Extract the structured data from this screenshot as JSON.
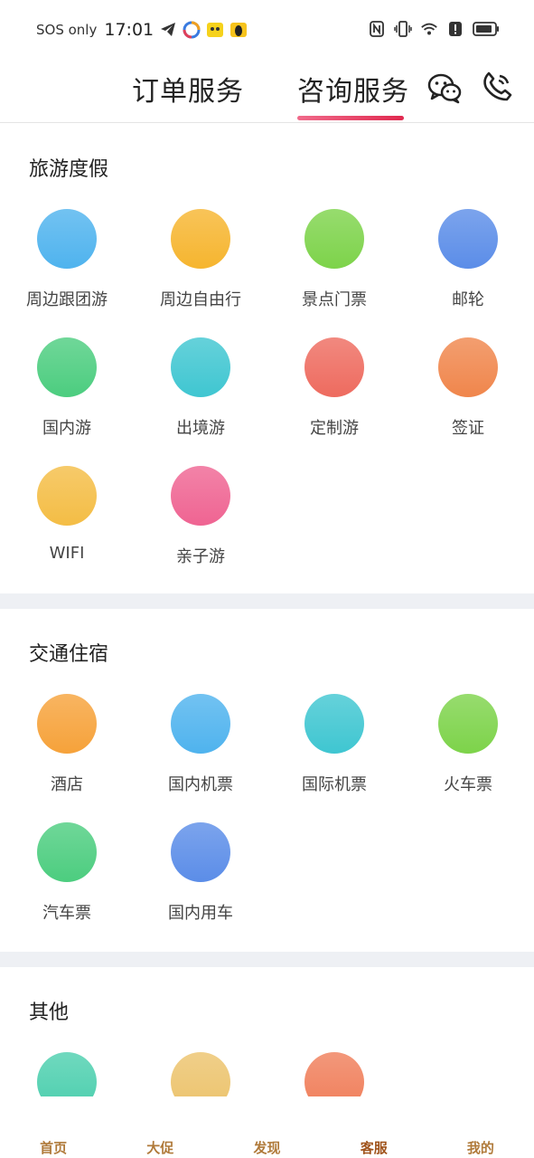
{
  "status_bar": {
    "carrier": "SOS only",
    "time": "17:01"
  },
  "header": {
    "tabs": [
      {
        "label": "订单服务"
      },
      {
        "label": "咨询服务"
      }
    ],
    "active_tab": 1
  },
  "sections": [
    {
      "title": "旅游度假",
      "items": [
        {
          "label": "周边跟团游",
          "icon": "flag-icon",
          "color": "#4fb3ee"
        },
        {
          "label": "周边自由行",
          "icon": "mountain-icon",
          "color": "#f6b52f"
        },
        {
          "label": "景点门票",
          "icon": "ticket-icon",
          "color": "#7dd34a"
        },
        {
          "label": "邮轮",
          "icon": "ship-icon",
          "color": "#5b8de8"
        },
        {
          "label": "国内游",
          "icon": "pagoda-icon",
          "color": "#4ccd7f"
        },
        {
          "label": "出境游",
          "icon": "paper-plane-icon",
          "color": "#3fc6d1"
        },
        {
          "label": "定制游",
          "icon": "building-icon",
          "color": "#ee6b5f"
        },
        {
          "label": "签证",
          "icon": "globe-icon",
          "color": "#f0864c"
        },
        {
          "label": "WIFI",
          "icon": "wifi-card-icon",
          "color": "#f4bd45"
        },
        {
          "label": "亲子游",
          "icon": "parent-child-icon",
          "color": "#ef6492"
        }
      ]
    },
    {
      "title": "交通住宿",
      "items": [
        {
          "label": "酒店",
          "icon": "hotel-icon",
          "color": "#f6a23a"
        },
        {
          "label": "国内机票",
          "icon": "airplane-icon",
          "color": "#4fb3ee"
        },
        {
          "label": "国际机票",
          "icon": "globe-plane-icon",
          "color": "#3fc6d1"
        },
        {
          "label": "火车票",
          "icon": "train-icon",
          "color": "#7dd34a"
        },
        {
          "label": "汽车票",
          "icon": "bus-icon",
          "color": "#4ccd7f"
        },
        {
          "label": "国内用车",
          "icon": "car-icon",
          "color": "#5b8de8"
        }
      ]
    },
    {
      "title": "其他",
      "items": [
        {
          "label": "",
          "icon": "basket-icon",
          "color": "#4ccfae"
        },
        {
          "label": "",
          "icon": "diamond-icon",
          "color": "#ecc36c"
        },
        {
          "label": "",
          "icon": "receipt-icon",
          "color": "#f07e5a"
        }
      ]
    }
  ],
  "bottom_nav": [
    {
      "label": "首页",
      "icon": "home-icon"
    },
    {
      "label": "大促",
      "icon": "persimmon-icon"
    },
    {
      "label": "发现",
      "icon": "ginkgo-icon"
    },
    {
      "label": "客服",
      "icon": "flower-icon"
    },
    {
      "label": "我的",
      "icon": "maple-leaf-icon"
    }
  ],
  "bottom_nav_active": 3
}
